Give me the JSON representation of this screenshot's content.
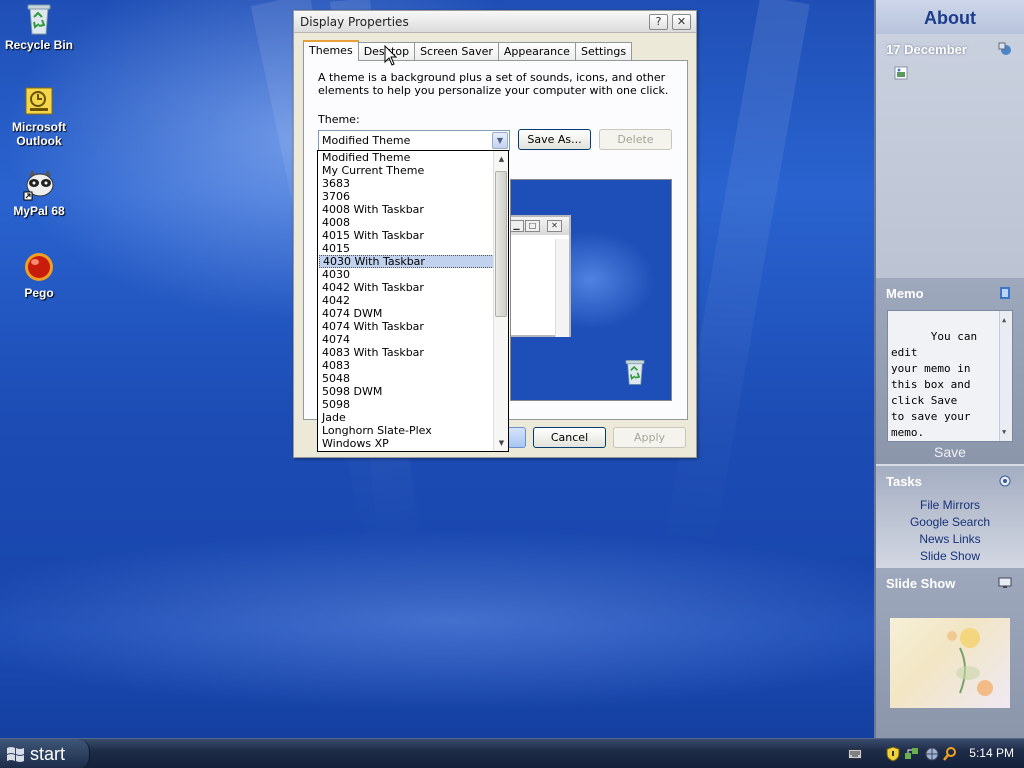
{
  "desktop": {
    "icons": [
      {
        "label": "Recycle Bin"
      },
      {
        "label": "Microsoft\nOutlook"
      },
      {
        "label": "MyPal 68"
      },
      {
        "label": "Pego"
      }
    ]
  },
  "dialog": {
    "title": "Display Properties",
    "help_glyph": "?",
    "close_glyph": "✕",
    "tabs": [
      "Themes",
      "Desktop",
      "Screen Saver",
      "Appearance",
      "Settings"
    ],
    "description": "A theme is a background plus a set of sounds, icons, and other elements to help you personalize your computer with one click.",
    "theme_label": "Theme:",
    "selected_theme": "Modified Theme",
    "save_as_label": "Save As...",
    "delete_label": "Delete",
    "cancel_label": "Cancel",
    "apply_label": "Apply",
    "theme_options": [
      "Modified Theme",
      "My Current Theme",
      "3683",
      "3706",
      "4008 With Taskbar",
      "4008",
      "4015 With Taskbar",
      "4015",
      "4030 With Taskbar",
      "4030",
      "4042 With Taskbar",
      "4042",
      "4074 DWM",
      "4074 With Taskbar",
      "4074",
      "4083 With Taskbar",
      "4083",
      "5048",
      "5098 DWM",
      "5098",
      "Jade",
      "Longhorn Slate-Plex",
      "Windows XP"
    ],
    "highlighted_option": "4030 With Taskbar"
  },
  "sidebar": {
    "title": "About",
    "date": "17 December",
    "memo_title": "Memo",
    "memo_text": "You can edit\nyour memo in\nthis box and\nclick Save\nto save your\nmemo.",
    "save_label": "Save",
    "tasks_title": "Tasks",
    "tasks": [
      "File Mirrors",
      "Google Search",
      "News Links",
      "Slide Show"
    ],
    "slideshow_title": "Slide Show"
  },
  "taskbar": {
    "start_label": "start",
    "clock": "5:14 PM"
  }
}
